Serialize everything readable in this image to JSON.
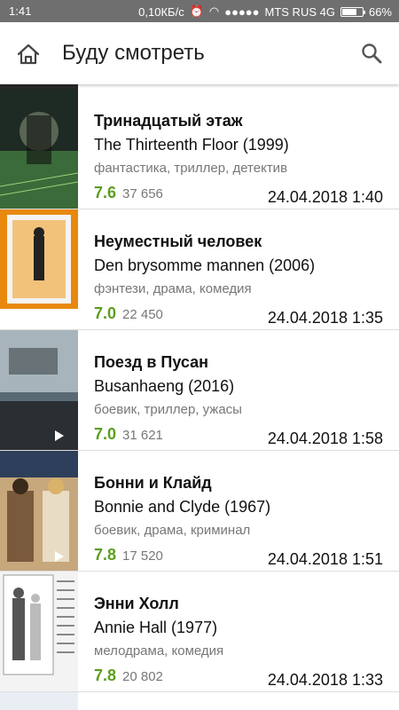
{
  "status_bar": {
    "time": "1:41",
    "network_speed": "0,10КБ/с",
    "carrier": "MTS RUS 4G",
    "battery": "66%"
  },
  "appbar": {
    "title": "Буду смотреть",
    "home_icon": "home-icon",
    "search_icon": "search-icon"
  },
  "movies": [
    {
      "title_ru": "Тринадцатый этаж",
      "title_orig": "The Thirteenth Floor (1999)",
      "genres": "фантастика, триллер, детектив",
      "rating": "7.6",
      "votes": "37 656",
      "added": "24.04.2018 1:40",
      "poster_colors": [
        "#1e2a24",
        "#3b6b3a",
        "#c8d6b0"
      ]
    },
    {
      "title_ru": "Неуместный человек",
      "title_orig": "Den brysomme mannen (2006)",
      "genres": "фэнтези, драма, комедия",
      "rating": "7.0",
      "votes": "22 450",
      "added": "24.04.2018 1:35",
      "poster_colors": [
        "#e8890e",
        "#f2c27a",
        "#f4f4f4"
      ]
    },
    {
      "title_ru": "Поезд в Пусан",
      "title_orig": "Busanhaeng (2016)",
      "genres": "боевик, триллер, ужасы",
      "rating": "7.0",
      "votes": "31 621",
      "added": "24.04.2018 1:58",
      "poster_colors": [
        "#5a6a75",
        "#a7b4bb",
        "#2a2f33"
      ]
    },
    {
      "title_ru": "Бонни и Клайд",
      "title_orig": "Bonnie and Clyde (1967)",
      "genres": "боевик, драма, криминал",
      "rating": "7.8",
      "votes": "17 520",
      "added": "24.04.2018 1:51",
      "poster_colors": [
        "#7a5a3c",
        "#c7a77c",
        "#2d3f5a"
      ]
    },
    {
      "title_ru": "Энни Холл",
      "title_orig": "Annie Hall (1977)",
      "genres": "мелодрама, комедия",
      "rating": "7.8",
      "votes": "20 802",
      "added": "24.04.2018 1:33",
      "poster_colors": [
        "#f3f3f3",
        "#555555",
        "#bbbbbb"
      ]
    }
  ]
}
